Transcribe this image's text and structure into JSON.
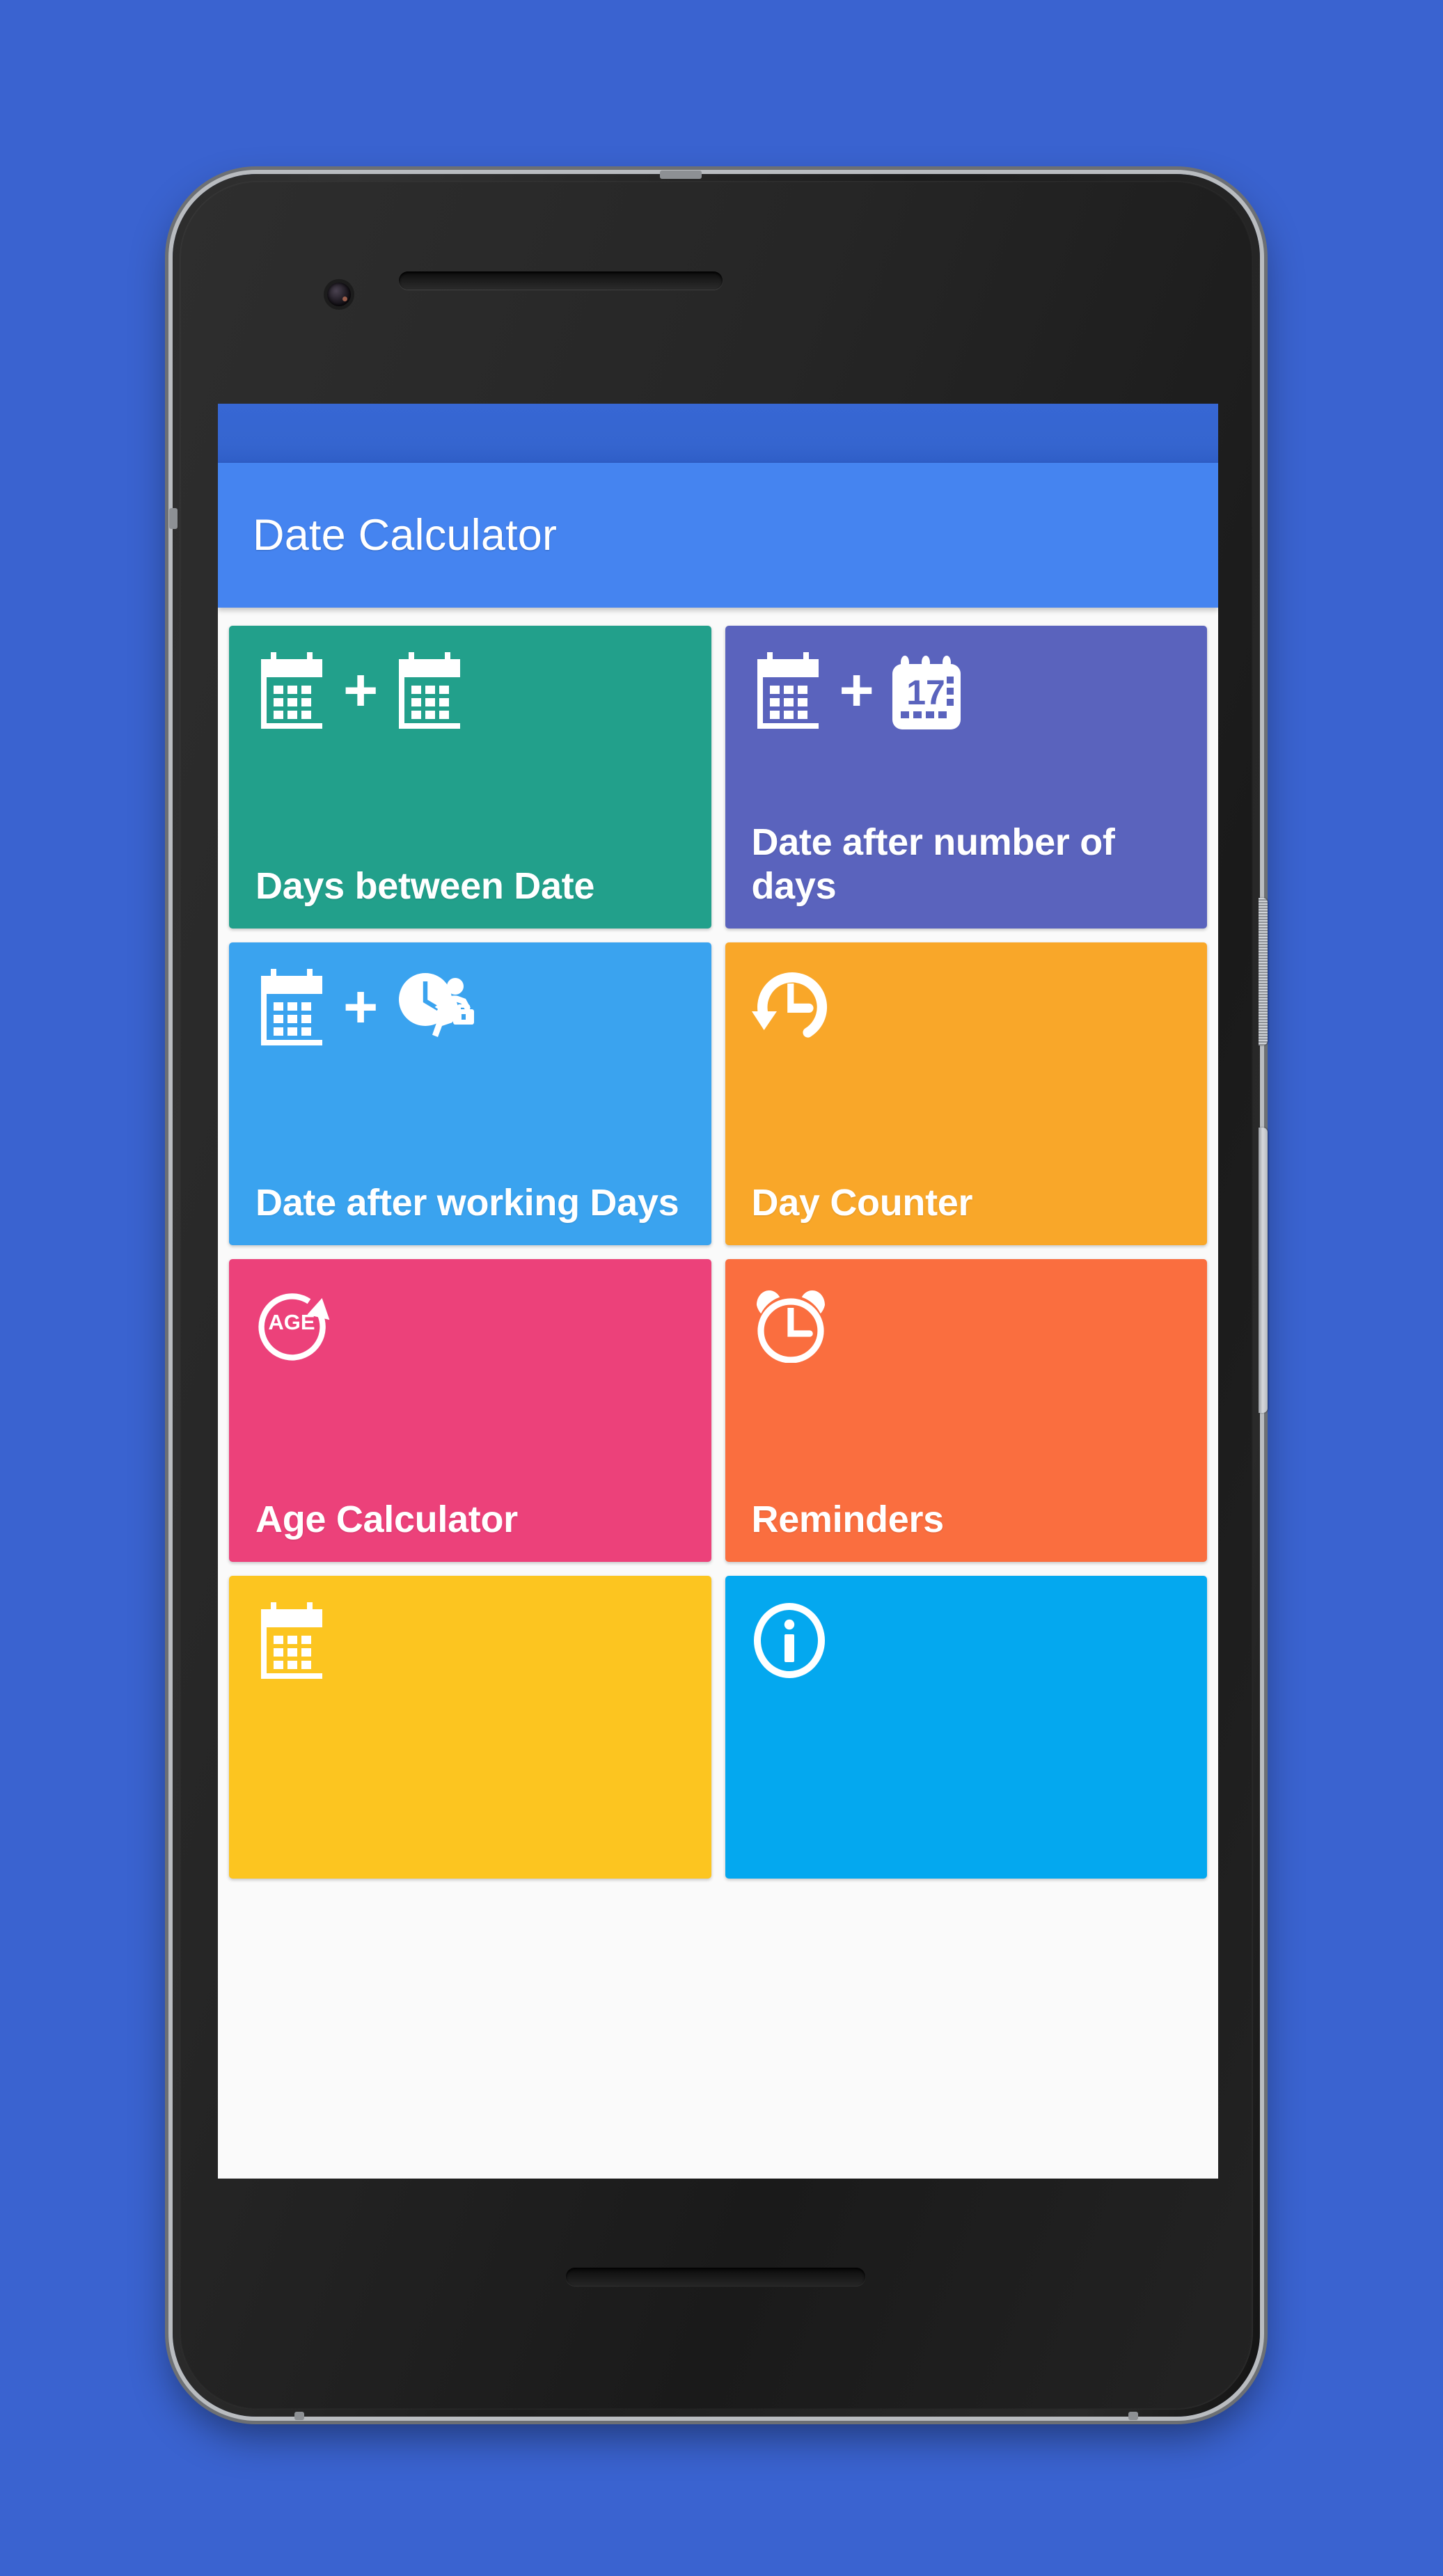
{
  "app": {
    "title": "Date Calculator",
    "status_bar_color": "#3565cf",
    "app_bar_color": "#4584f0",
    "background_color": "#3a63d0",
    "screen_background": "#fafafa"
  },
  "tiles": [
    {
      "id": "days-between-date",
      "label": "Days between Date",
      "color": "#22a08b",
      "icons": [
        "calendar-icon",
        "plus-icon",
        "calendar-icon"
      ]
    },
    {
      "id": "date-after-number-of-days",
      "label": "Date after number of days",
      "color": "#5a63bd",
      "icons": [
        "calendar-icon",
        "plus-icon",
        "calendar-17-icon"
      ],
      "icon_day_number": "17"
    },
    {
      "id": "date-after-working-days",
      "label": "Date after working Days",
      "color": "#3aa3ef",
      "icons": [
        "calendar-icon",
        "plus-icon",
        "clock-businessman-icon"
      ]
    },
    {
      "id": "day-counter",
      "label": "Day Counter",
      "color": "#f9a729",
      "icons": [
        "clock-restore-icon"
      ]
    },
    {
      "id": "age-calculator",
      "label": "Age Calculator",
      "color": "#ec417a",
      "icons": [
        "age-circle-arrow-icon"
      ],
      "icon_text": "AGE"
    },
    {
      "id": "reminders",
      "label": "Reminders",
      "color": "#fa6e3f",
      "icons": [
        "alarm-clock-icon"
      ]
    },
    {
      "id": "calendar-tile",
      "label": "",
      "color": "#fcc520",
      "icons": [
        "calendar-icon"
      ]
    },
    {
      "id": "about-info",
      "label": "",
      "color": "#04a8ef",
      "icons": [
        "info-circle-icon"
      ]
    }
  ]
}
